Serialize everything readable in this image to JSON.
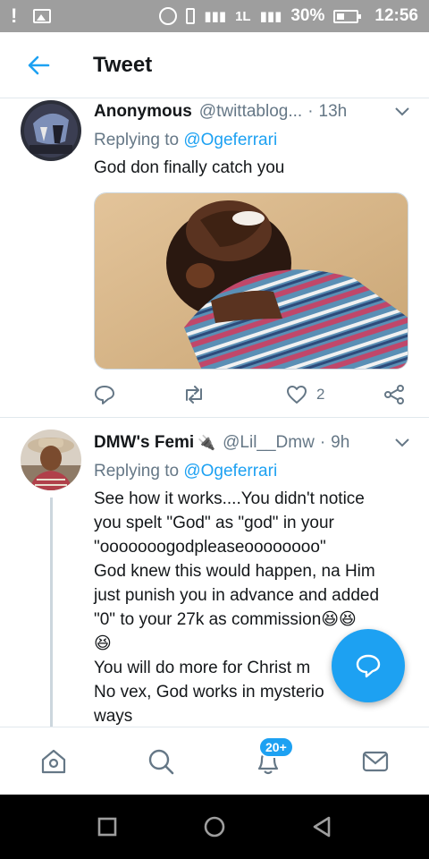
{
  "status_bar": {
    "left_icons": [
      "alert-icon",
      "image-icon"
    ],
    "battery": "30%",
    "time": "12:56",
    "signal_1": "شال",
    "net_label": "1L"
  },
  "header": {
    "title": "Tweet",
    "back_icon": "back-arrow-icon"
  },
  "tweets": [
    {
      "name": "Anonymous",
      "handle": "@twittablog...",
      "separator": "·",
      "time": "13h",
      "replying_label": "Replying to ",
      "replying_to": "@Ogeferrari",
      "text": "God don finally catch you",
      "media": "photo of a laughing child in a striped shirt",
      "like_count": "2"
    },
    {
      "name": "DMW's Femi",
      "name_emoji": "🔌",
      "handle": "@Lil__Dmw",
      "separator": "·",
      "time": "9h",
      "replying_label": "Replying to ",
      "replying_to": "@Ogeferrari",
      "text_lines": [
        "See how it works....You didn't notice",
        "you spelt \"God\" as \"god\" in your",
        "\"ooooooogodpleaseoooooooo\"",
        "God knew this would happen, na Him",
        "just punish you in advance and added",
        "\"0\" to your 27k as commission😆😆",
        "😆",
        "You will do more for Christ m",
        "No vex, God works in mysterio",
        "ways"
      ]
    }
  ],
  "bottom_nav": {
    "items": [
      "home-icon",
      "search-icon",
      "notifications-icon",
      "messages-icon"
    ],
    "notifications_badge": "20+"
  },
  "colors": {
    "accent": "#1da1f2",
    "status_bar": "#9e9e9e",
    "secondary_text": "#657786"
  }
}
